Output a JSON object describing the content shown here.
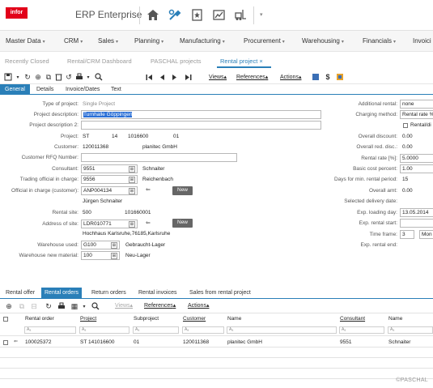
{
  "app": {
    "logo": "infor",
    "title": "ERP Enterprise"
  },
  "top_icons": [
    "home-icon",
    "tools-icon",
    "favorite-page-icon",
    "chart-icon",
    "forklift-icon"
  ],
  "main_menu": [
    {
      "label": "Master Data"
    },
    {
      "label": "CRM"
    },
    {
      "label": "Sales"
    },
    {
      "label": "Planning"
    },
    {
      "label": "Manufacturing"
    },
    {
      "label": "Procurement"
    },
    {
      "label": "Warehousing"
    },
    {
      "label": "Financials"
    },
    {
      "label": "Invoici"
    }
  ],
  "nav_tabs": [
    {
      "label": "Recently Closed"
    },
    {
      "label": "Rental/CRM Dashboard"
    },
    {
      "label": "PASCHAL projects"
    },
    {
      "label": "Rental project",
      "close": "×",
      "active": true
    }
  ],
  "toolbar": {
    "views": "Views",
    "references": "References",
    "actions": "Actions"
  },
  "sub_tabs": [
    {
      "label": "General",
      "active": true
    },
    {
      "label": "Details"
    },
    {
      "label": "Invoice/Dates"
    },
    {
      "label": "Text"
    }
  ],
  "form": {
    "type_of_project": {
      "label": "Type of project:",
      "value": "Single Project"
    },
    "project_description": {
      "label": "Project description:",
      "value": "Turnhalle Göppingen"
    },
    "project_description_2": {
      "label": "Project description 2:",
      "value": ""
    },
    "project": {
      "label": "Project:",
      "part1": "ST",
      "part2": "14",
      "part3": "1016600",
      "part4": "01"
    },
    "customer": {
      "label": "Customer:",
      "id": "120011368",
      "name": "planitec GmbH"
    },
    "customer_rfq": {
      "label": "Customer RFQ Number:",
      "value": ""
    },
    "consultant": {
      "label": "Consultant:",
      "id": "9551",
      "name": "Schnaiter"
    },
    "trading_official": {
      "label": "Trading official in charge:",
      "id": "9556",
      "name": "Reichenbach"
    },
    "official_customer": {
      "label": "Official in charge (customer):",
      "id": "ANP004134",
      "new": "New",
      "name": "Jürgen Schnaiter"
    },
    "rental_site": {
      "label": "Rental site:",
      "id": "500",
      "code": "101660001"
    },
    "address_of_site": {
      "label": "Address of site:",
      "id": "LDR010771",
      "new": "New",
      "address": "Hochhaus Karlsruhe,76185,Karlsruhe"
    },
    "warehouse_used": {
      "label": "Warehouse used:",
      "id": "G100",
      "name": "Gebraucht-Lager"
    },
    "warehouse_new": {
      "label": "Warehouse new material:",
      "id": "100",
      "name": "Neu-Lager"
    }
  },
  "right_form": {
    "additional_rental": {
      "label": "Additional rental:",
      "value": "none"
    },
    "charging_method": {
      "label": "Charging method:",
      "value": "Rental rate %"
    },
    "rental_di": {
      "label": "Rental/di"
    },
    "overall_discount": {
      "label": "Overall discount:",
      "value": "0.00"
    },
    "overall_red_disc": {
      "label": "Overall red. disc.:",
      "value": "0.00"
    },
    "rental_rate": {
      "label": "Rental rate [%]:",
      "value": "5.0000"
    },
    "basic_cost_percent": {
      "label": "Basic cost percent:",
      "value": "1.00"
    },
    "days_min_rental": {
      "label": "Days for min. rental period:",
      "value": "15"
    },
    "overall_amt": {
      "label": "Overall amt:",
      "value": "0.00"
    },
    "selected_delivery": {
      "label": "Selected delivery date:",
      "value": ""
    },
    "exp_loading_day": {
      "label": "Exp. loading day:",
      "value": "13.05.2014"
    },
    "exp_rental_start": {
      "label": "Exp. rental start:",
      "value": ""
    },
    "time_frame": {
      "label": "Time frame:",
      "value": "3",
      "unit": "Mon"
    },
    "exp_rental_end": {
      "label": "Exp. rental end:",
      "value": ""
    }
  },
  "bottom_tabs": [
    {
      "label": "Rental offer"
    },
    {
      "label": "Rental orders",
      "active": true
    },
    {
      "label": "Return orders"
    },
    {
      "label": "Rental invoices"
    },
    {
      "label": "Sales from rental project"
    }
  ],
  "grid_toolbar": {
    "views": "Views",
    "references": "References",
    "actions": "Actions"
  },
  "grid": {
    "headers": [
      "Rental order",
      "Project",
      "Subproject",
      "Customer",
      "Name",
      "Consultant",
      "Name"
    ],
    "filter_placeholder": "Aₐ",
    "rows": [
      {
        "rental_order": "100025372",
        "project": "ST 141016600",
        "subproject": "01",
        "customer": "120011368",
        "name": "planitec GmbH",
        "consultant": "9551",
        "consultant_name": "Schnaiter"
      }
    ]
  },
  "copyright": "©PASCHAL",
  "colors": {
    "accent": "#2a7fb8",
    "brand": "#e2001a"
  }
}
